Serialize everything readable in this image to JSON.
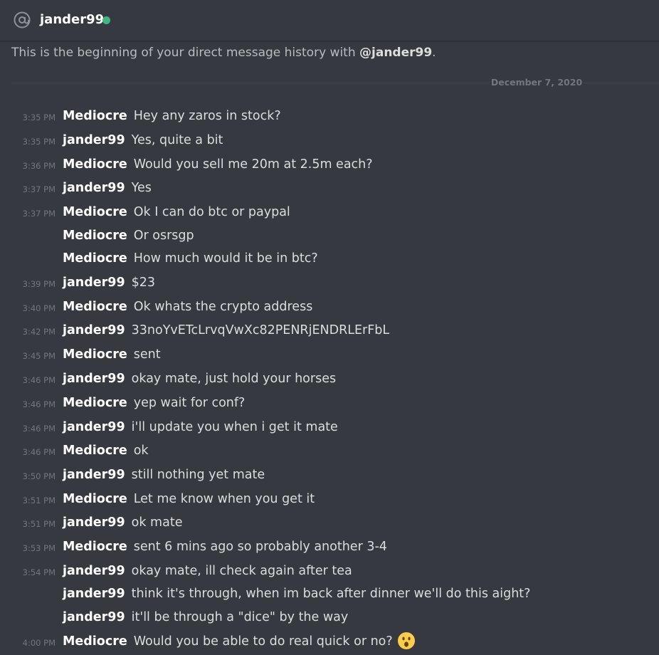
{
  "header": {
    "username": "jander99",
    "status_color": "#43b581"
  },
  "intro": {
    "prefix": "This is the beginning of your direct message history with ",
    "mention": "@jander99",
    "suffix": "."
  },
  "divider": {
    "date": "December 7, 2020"
  },
  "messages": [
    {
      "time": "3:35 PM",
      "author": "Mediocre",
      "text": "Hey any zaros in stock?"
    },
    {
      "time": "3:35 PM",
      "author": "jander99",
      "text": "Yes, quite a bit"
    },
    {
      "time": "3:36 PM",
      "author": "Mediocre",
      "text": "Would you sell me 20m at 2.5m each?"
    },
    {
      "time": "3:37 PM",
      "author": "jander99",
      "text": "Yes"
    },
    {
      "time": "3:37 PM",
      "author": "Mediocre",
      "text": "Ok I can do btc or paypal"
    },
    {
      "time": "",
      "author": "Mediocre",
      "text": "Or osrsgp"
    },
    {
      "time": "",
      "author": "Mediocre",
      "text": "How much would it be in btc?"
    },
    {
      "time": "3:39 PM",
      "author": "jander99",
      "text": "$23"
    },
    {
      "time": "3:40 PM",
      "author": "Mediocre",
      "text": "Ok whats the crypto address"
    },
    {
      "time": "3:42 PM",
      "author": "jander99",
      "text": "33noYvETcLrvqVwXc82PENRjENDRLErFbL"
    },
    {
      "time": "3:45 PM",
      "author": "Mediocre",
      "text": "sent"
    },
    {
      "time": "3:46 PM",
      "author": "jander99",
      "text": "okay mate, just hold your horses"
    },
    {
      "time": "3:46 PM",
      "author": "Mediocre",
      "text": "yep wait for conf?"
    },
    {
      "time": "3:46 PM",
      "author": "jander99",
      "text": "i'll update you when i get it mate"
    },
    {
      "time": "3:46 PM",
      "author": "Mediocre",
      "text": "ok"
    },
    {
      "time": "3:50 PM",
      "author": "jander99",
      "text": "still nothing yet mate"
    },
    {
      "time": "3:51 PM",
      "author": "Mediocre",
      "text": "Let me know when you get it"
    },
    {
      "time": "3:51 PM",
      "author": "jander99",
      "text": "ok mate"
    },
    {
      "time": "3:53 PM",
      "author": "Mediocre",
      "text": "sent 6 mins ago so probably another 3-4"
    },
    {
      "time": "3:54 PM",
      "author": "jander99",
      "text": "okay mate, ill check again after tea"
    },
    {
      "time": "",
      "author": "jander99",
      "text": "think it's through, when im back after dinner we'll do this aight?"
    },
    {
      "time": "",
      "author": "jander99",
      "text": "it'll be through a \"dice\" by the way"
    },
    {
      "time": "4:00 PM",
      "author": "Mediocre",
      "text": "Would you be able to do real quick or no?",
      "emoji": "hushed-face-emoji"
    }
  ]
}
